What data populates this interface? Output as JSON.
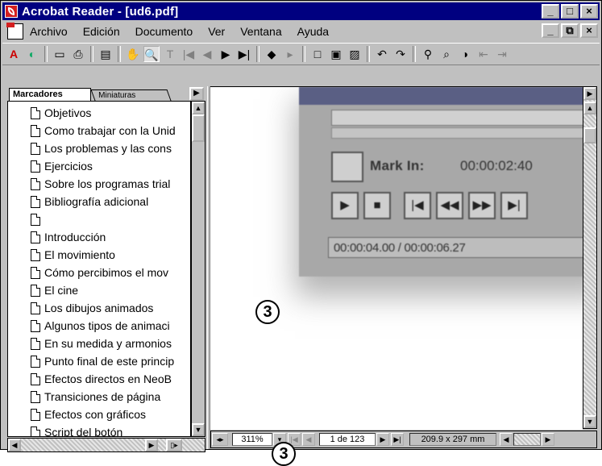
{
  "window": {
    "title": "Acrobat Reader - [ud6.pdf]",
    "controls": [
      "_",
      "□",
      "×"
    ]
  },
  "menubar": {
    "items": [
      {
        "label": "Archivo"
      },
      {
        "label": "Edición"
      },
      {
        "label": "Documento"
      },
      {
        "label": "Ver"
      },
      {
        "label": "Ventana"
      },
      {
        "label": "Ayuda"
      }
    ],
    "doc_controls": [
      "_",
      "⧉",
      "×"
    ]
  },
  "toolbar": {
    "buttons": [
      {
        "name": "acrobat-logo-icon",
        "glyph": "A"
      },
      {
        "name": "globe-icon",
        "glyph": "◐"
      },
      {
        "name": "open-folder-icon",
        "glyph": "▭"
      },
      {
        "name": "print-icon",
        "glyph": "⎙"
      },
      {
        "name": "toggle-panel-icon",
        "glyph": "▤"
      },
      {
        "name": "hand-tool-icon",
        "glyph": "✋"
      },
      {
        "name": "zoom-tool-icon",
        "glyph": "🔍"
      },
      {
        "name": "text-select-icon",
        "glyph": "T"
      },
      {
        "name": "first-page-icon",
        "glyph": "|◀"
      },
      {
        "name": "prev-page-icon",
        "glyph": "◀"
      },
      {
        "name": "next-page-icon",
        "glyph": "▶"
      },
      {
        "name": "last-page-icon",
        "glyph": "▶|"
      },
      {
        "name": "go-back-icon",
        "glyph": "◆"
      },
      {
        "name": "go-forward-icon",
        "glyph": "▸"
      },
      {
        "name": "actual-size-icon",
        "glyph": "□"
      },
      {
        "name": "fit-page-icon",
        "glyph": "▣"
      },
      {
        "name": "fit-width-icon",
        "glyph": "▨"
      },
      {
        "name": "rotate-left-icon",
        "glyph": "↶"
      },
      {
        "name": "rotate-right-icon",
        "glyph": "↷"
      },
      {
        "name": "find-icon",
        "glyph": "⚲"
      },
      {
        "name": "search-icon",
        "glyph": "⌕"
      },
      {
        "name": "search-results-icon",
        "glyph": "◑"
      },
      {
        "name": "prev-highlight-icon",
        "glyph": "⇤"
      },
      {
        "name": "next-highlight-icon",
        "glyph": "⇥"
      }
    ]
  },
  "left_panel": {
    "tab_active": "Marcadores",
    "tab_inactive": "Miniaturas",
    "bookmarks": [
      "Objetivos",
      "Como trabajar con la Unid",
      "Los problemas y las cons",
      "Ejercicios",
      "Sobre los programas trial",
      "Bibliografía adicional",
      "",
      "Introducción",
      "El movimiento",
      "Cómo percibimos el mov",
      "El cine",
      "Los dibujos animados",
      "Algunos tipos de animaci",
      "En su medida y armonios",
      "Punto final de este princip",
      "Efectos directos en NeoB",
      "Transiciones de página",
      "Efectos con gráficos",
      "Script del botón"
    ]
  },
  "document": {
    "mark_in_label": "Mark In:",
    "mark_in_value": "00:00:02:40",
    "timecode": "00:00:04.00 / 00:00:06.27",
    "callout_main": "3",
    "callout_bottom": "3"
  },
  "statusbar": {
    "zoom": "311%",
    "page": "1 de 123",
    "page_size": "209.9 x 297 mm"
  }
}
